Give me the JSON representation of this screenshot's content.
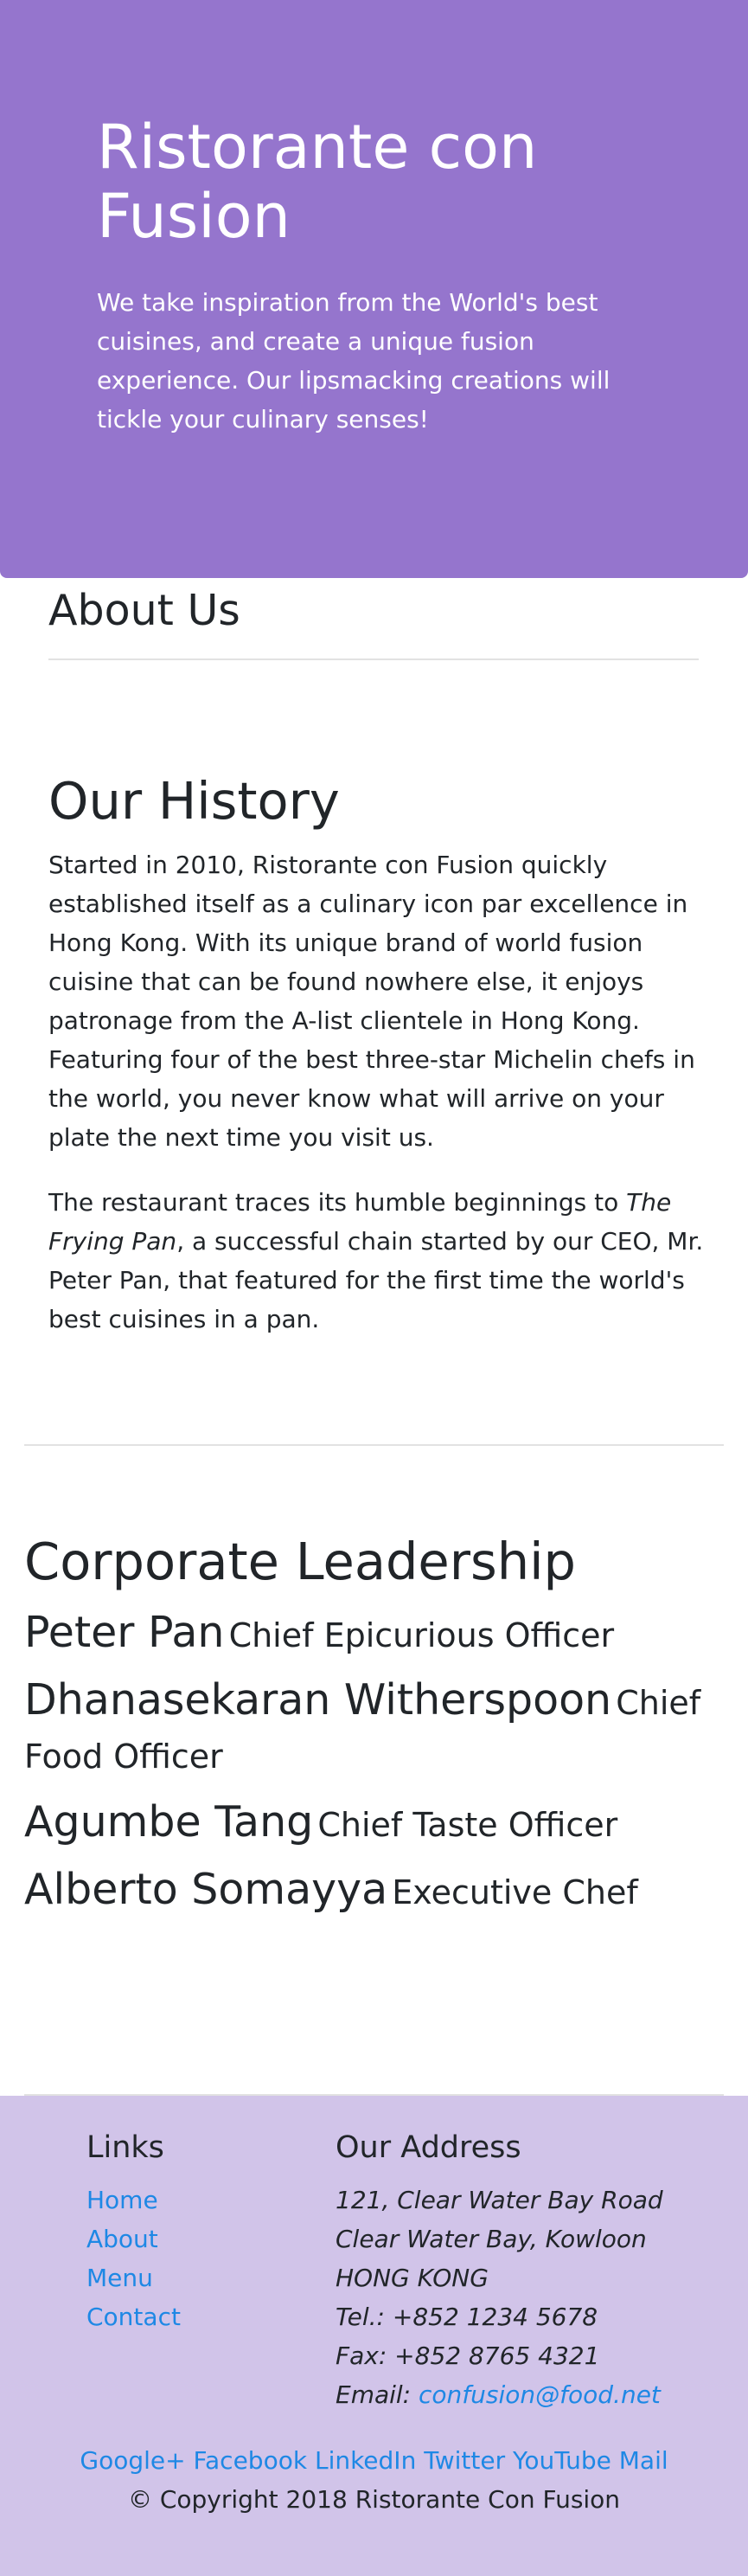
{
  "jumbotron": {
    "title": "Ristorante con Fusion",
    "text": "We take inspiration from the World's best cuisines, and create a unique fusion experience. Our lipsmacking creations will tickle your culinary senses!"
  },
  "about": {
    "heading": "About Us"
  },
  "history": {
    "heading": "Our History",
    "paragraph1": "Started in 2010, Ristorante con Fusion quickly established itself as a culinary icon par excellence in Hong Kong. With its unique brand of world fusion cuisine that can be found nowhere else, it enjoys patronage from the A-list clientele in Hong Kong. Featuring four of the best three-star Michelin chefs in the world, you never know what will arrive on your plate the next time you visit us.",
    "paragraph2_prefix": "The restaurant traces its humble beginnings to ",
    "paragraph2_emphasis": "The Frying Pan",
    "paragraph2_suffix": ", a successful chain started by our CEO, Mr. Peter Pan, that featured for the first time the world's best cuisines in a pan."
  },
  "leadership": {
    "heading": "Corporate Leadership",
    "leaders": [
      {
        "name": "Peter Pan",
        "role": "Chief Epicurious Officer"
      },
      {
        "name": "Dhanasekaran Witherspoon",
        "role": "Chief Food Officer"
      },
      {
        "name": "Agumbe Tang",
        "role": "Chief Taste Officer"
      },
      {
        "name": "Alberto Somayya",
        "role": "Executive Chef"
      }
    ]
  },
  "footer": {
    "links_heading": "Links",
    "links": [
      "Home",
      "About",
      "Menu",
      "Contact"
    ],
    "address_heading": "Our Address",
    "address_lines": [
      "121, Clear Water Bay Road",
      "Clear Water Bay, Kowloon",
      "HONG KONG",
      "Tel.: +852 1234 5678",
      "Fax: +852 8765 4321"
    ],
    "email_label": "Email: ",
    "email": "confusion@food.net",
    "social": [
      "Google+",
      "Facebook",
      "LinkedIn",
      "Twitter",
      "YouTube",
      "Mail"
    ],
    "copyright": "© Copyright 2018 Ristorante Con Fusion"
  },
  "colors": {
    "jumbotron_bg": "#9575cd",
    "footer_bg": "#d1c4e9",
    "link": "#1e88e5"
  }
}
